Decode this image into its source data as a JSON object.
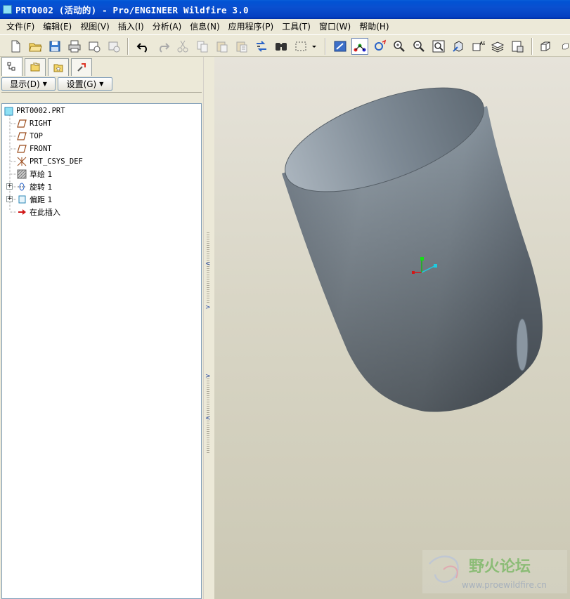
{
  "window": {
    "title": "PRT0002 (活动的) - Pro/ENGINEER Wildfire 3.0"
  },
  "menu": [
    "文件(F)",
    "编辑(E)",
    "视图(V)",
    "插入(I)",
    "分析(A)",
    "信息(N)",
    "应用程序(P)",
    "工具(T)",
    "窗口(W)",
    "帮助(H)"
  ],
  "toolbar": {
    "icons": [
      "new-file-icon",
      "open-folder-icon",
      "save-icon",
      "print-icon",
      "send-mail-icon",
      "mail-gray-icon",
      "undo-icon",
      "redo-icon",
      "cut-icon",
      "copy-icon",
      "paste-icon",
      "paste-special-icon",
      "regenerate-icon",
      "find-icon",
      "select-box-icon",
      "repaint-icon",
      "spin-center-icon",
      "orient-mode-icon",
      "zoom-in-icon",
      "zoom-out-icon",
      "refit-icon",
      "reorient-icon",
      "saved-views-icon",
      "layers-icon",
      "view-manager-icon",
      "display-style-icon"
    ]
  },
  "left_panel": {
    "show_button": "显示(D)",
    "settings_button": "设置(G)",
    "tree": [
      {
        "label": "PRT0002.PRT",
        "icon": "part-icon"
      },
      {
        "label": "RIGHT",
        "icon": "datum-plane-icon"
      },
      {
        "label": "TOP",
        "icon": "datum-plane-icon"
      },
      {
        "label": "FRONT",
        "icon": "datum-plane-icon"
      },
      {
        "label": "PRT_CSYS_DEF",
        "icon": "csys-icon"
      },
      {
        "label": "草绘 1",
        "icon": "sketch-icon"
      },
      {
        "label": "旋转 1",
        "icon": "revolve-icon"
      },
      {
        "label": "偏距 1",
        "icon": "offset-icon"
      },
      {
        "label": "在此插入",
        "icon": "insert-here-arrow-icon"
      }
    ]
  },
  "watermark": {
    "title": "野火论坛",
    "url": "www.proewildfire.cn"
  },
  "colors": {
    "title_bar": "#0a4fcf",
    "menu_bg": "#ece9d8",
    "model": "#8a96a1"
  }
}
